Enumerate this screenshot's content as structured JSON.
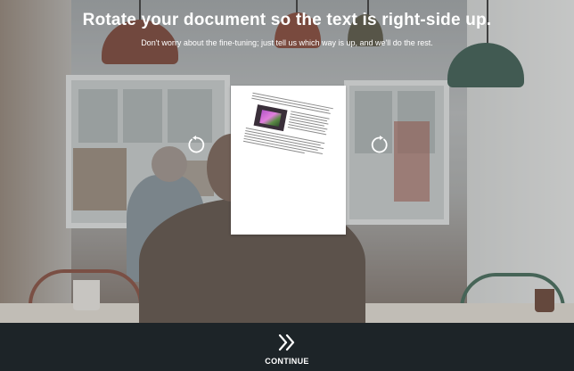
{
  "header": {
    "title": "Rotate your document so the text is right-side up.",
    "subtitle": "Don't worry about the fine-tuning; just tell us which way is up, and we'll do the rest."
  },
  "controls": {
    "rotate_left_icon": "rotate-counterclockwise-icon",
    "rotate_right_icon": "rotate-clockwise-icon",
    "continue_icon": "double-chevron-right-icon",
    "continue_label": "CONTINUE"
  },
  "colors": {
    "bottom_bar": "#1d2428",
    "text": "#ffffff",
    "document": "#ffffff"
  }
}
